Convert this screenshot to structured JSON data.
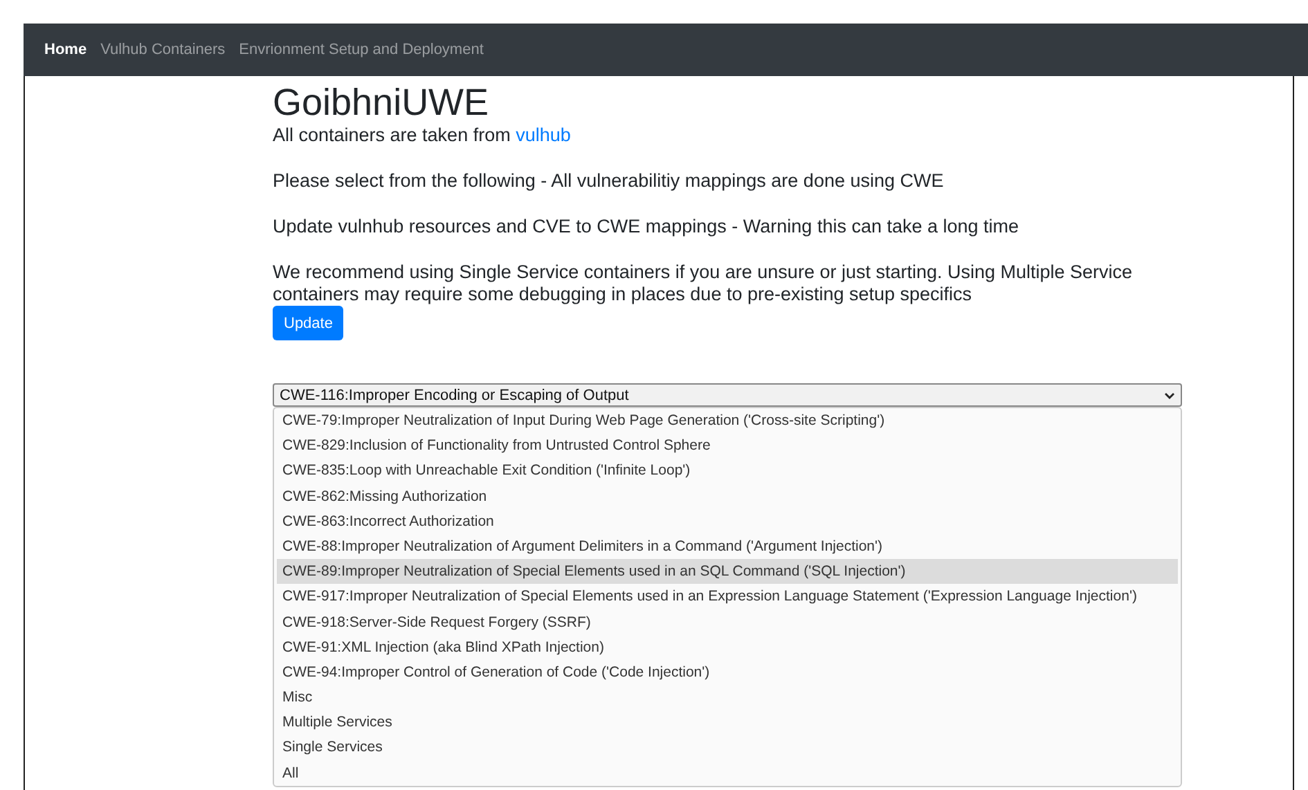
{
  "navbar": {
    "items": [
      {
        "label": "Home",
        "selected": true
      },
      {
        "label": "Vulhub Containers",
        "selected": false
      },
      {
        "label": "Envrionment Setup and Deployment",
        "selected": false
      }
    ]
  },
  "heading": "GoibhniUWE",
  "source_text": "All containers are taken from ",
  "source_link": "vulhub",
  "paragraphs": [
    "Please select from the following - All vulnerabilitiy mappings are done using CWE",
    "Update vulnhub resources and CVE to CWE mappings - Warning this can take a long time",
    "We recommend using Single Service containers if you are unsure or just starting. Using Multiple Service containers may require some debugging in places due to pre-existing setup specifics"
  ],
  "update_button": "Update",
  "select": {
    "value": "CWE-116:Improper Encoding or Escaping of Output",
    "expanded": true,
    "options": [
      {
        "label": "CWE-79:Improper Neutralization of Input During Web Page Generation ('Cross-site Scripting')",
        "selected": false
      },
      {
        "label": "CWE-829:Inclusion of Functionality from Untrusted Control Sphere",
        "selected": false
      },
      {
        "label": "CWE-835:Loop with Unreachable Exit Condition ('Infinite Loop')",
        "selected": false
      },
      {
        "label": "CWE-862:Missing Authorization",
        "selected": false
      },
      {
        "label": "CWE-863:Incorrect Authorization",
        "selected": false
      },
      {
        "label": "CWE-88:Improper Neutralization of Argument Delimiters in a Command ('Argument Injection')",
        "selected": false
      },
      {
        "label": "CWE-89:Improper Neutralization of Special Elements used in an SQL Command ('SQL Injection')",
        "selected": true
      },
      {
        "label": "CWE-917:Improper Neutralization of Special Elements used in an Expression Language Statement ('Expression Language Injection')",
        "selected": false
      },
      {
        "label": "CWE-918:Server-Side Request Forgery (SSRF)",
        "selected": false
      },
      {
        "label": "CWE-91:XML Injection (aka Blind XPath Injection)",
        "selected": false
      },
      {
        "label": "CWE-94:Improper Control of Generation of Code ('Code Injection')",
        "selected": false
      },
      {
        "label": "Misc",
        "selected": false
      },
      {
        "label": "Multiple Services",
        "selected": false
      },
      {
        "label": "Single Services",
        "selected": false
      },
      {
        "label": "All",
        "selected": false
      }
    ]
  }
}
